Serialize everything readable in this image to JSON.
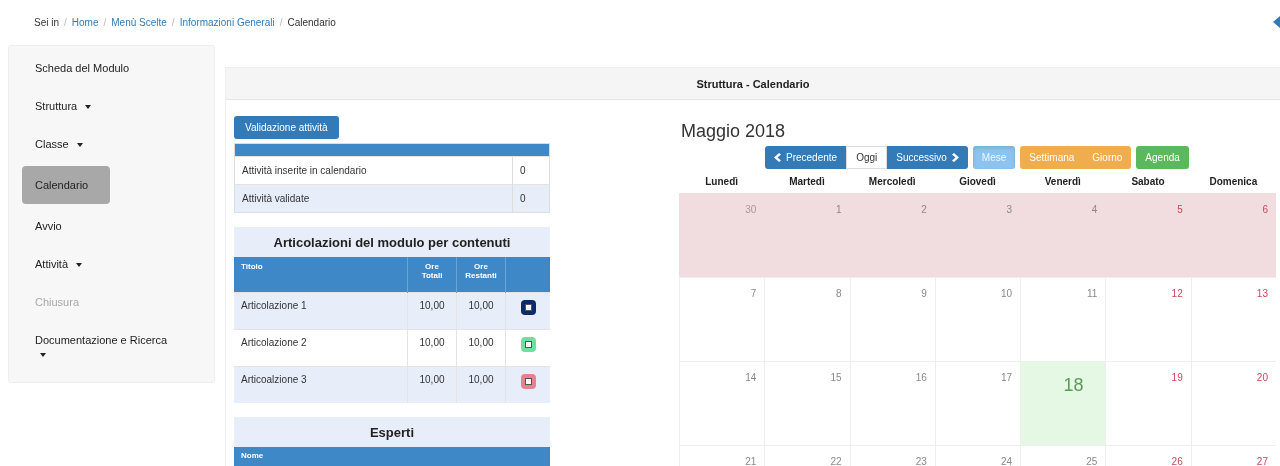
{
  "breadcrumb": {
    "prefix": "Sei in",
    "separator": "/",
    "items": [
      {
        "label": "Home",
        "link": true
      },
      {
        "label": "Menù Scelte",
        "link": true
      },
      {
        "label": "Informazioni Generali",
        "link": true
      },
      {
        "label": "Calendario",
        "link": false
      }
    ]
  },
  "sidebar": {
    "items": [
      {
        "label": "Scheda del Modulo",
        "dropdown": false,
        "selected": false,
        "disabled": false
      },
      {
        "label": "Struttura",
        "dropdown": true,
        "selected": false,
        "disabled": false
      },
      {
        "label": "Classe",
        "dropdown": true,
        "selected": false,
        "disabled": false
      },
      {
        "label": "Calendario",
        "dropdown": false,
        "selected": true,
        "disabled": false
      },
      {
        "label": "Avvio",
        "dropdown": false,
        "selected": false,
        "disabled": false
      },
      {
        "label": "Attività",
        "dropdown": true,
        "selected": false,
        "disabled": false
      },
      {
        "label": "Chiusura",
        "dropdown": false,
        "selected": false,
        "disabled": true
      },
      {
        "label": "Documentazione e Ricerca",
        "dropdown": true,
        "selected": false,
        "disabled": false
      }
    ]
  },
  "panel": {
    "title": "Struttura - Calendario"
  },
  "validation": {
    "button": "Validazione attività",
    "rows": [
      {
        "label": "Attività inserite in calendario",
        "value": "0"
      },
      {
        "label": "Attività validate",
        "value": "0"
      }
    ]
  },
  "articolazioni": {
    "title": "Articolazioni del modulo per contenuti",
    "columns": [
      "Titolo",
      "Ore Totali",
      "Ore Restanti"
    ],
    "rows": [
      {
        "title": "Articolazione 1",
        "ore_totali": "10,00",
        "ore_restanti": "10,00",
        "color": "#0b2a6b"
      },
      {
        "title": "Articolazione 2",
        "ore_totali": "10,00",
        "ore_restanti": "10,00",
        "color": "#6fe0a0"
      },
      {
        "title": "Articoalzione 3",
        "ore_totali": "10,00",
        "ore_restanti": "10,00",
        "color": "#e8808e"
      }
    ]
  },
  "esperti": {
    "title": "Esperti",
    "columns": [
      "Nome"
    ]
  },
  "calendar": {
    "title": "Maggio 2018",
    "nav": [
      {
        "label": "Precedente",
        "kind": "prev"
      },
      {
        "label": "Oggi",
        "kind": "today"
      },
      {
        "label": "Successivo",
        "kind": "next"
      }
    ],
    "views": [
      {
        "label": "Mese",
        "color": "#8cc4ef",
        "selected": true
      },
      {
        "label": "Settimana",
        "color": "#f0ad4e",
        "selected": false
      },
      {
        "label": "Giorno",
        "color": "#f0ad4e",
        "selected": false
      },
      {
        "label": "Agenda",
        "color": "#5cb85c",
        "selected": false
      }
    ],
    "weekdays": [
      "Lunedì",
      "Martedì",
      "Mercoledì",
      "Giovedì",
      "Venerdì",
      "Sabato",
      "Domenica"
    ],
    "weeks": [
      {
        "highlighted": true,
        "days": [
          {
            "label": "30",
            "kind": "other",
            "today": false
          },
          {
            "label": "1",
            "kind": "weekday",
            "today": false
          },
          {
            "label": "2",
            "kind": "weekday",
            "today": false
          },
          {
            "label": "3",
            "kind": "weekday",
            "today": false
          },
          {
            "label": "4",
            "kind": "weekday",
            "today": false
          },
          {
            "label": "5",
            "kind": "weekend",
            "today": false
          },
          {
            "label": "6",
            "kind": "weekend",
            "today": false
          }
        ]
      },
      {
        "highlighted": false,
        "days": [
          {
            "label": "7",
            "kind": "weekday",
            "today": false
          },
          {
            "label": "8",
            "kind": "weekday",
            "today": false
          },
          {
            "label": "9",
            "kind": "weekday",
            "today": false
          },
          {
            "label": "10",
            "kind": "weekday",
            "today": false
          },
          {
            "label": "11",
            "kind": "weekday",
            "today": false
          },
          {
            "label": "12",
            "kind": "weekend",
            "today": false
          },
          {
            "label": "13",
            "kind": "weekend",
            "today": false
          }
        ]
      },
      {
        "highlighted": false,
        "days": [
          {
            "label": "14",
            "kind": "weekday",
            "today": false
          },
          {
            "label": "15",
            "kind": "weekday",
            "today": false
          },
          {
            "label": "16",
            "kind": "weekday",
            "today": false
          },
          {
            "label": "17",
            "kind": "weekday",
            "today": false
          },
          {
            "label": "18",
            "kind": "weekday",
            "today": true
          },
          {
            "label": "19",
            "kind": "weekend",
            "today": false
          },
          {
            "label": "20",
            "kind": "weekend",
            "today": false
          }
        ]
      },
      {
        "highlighted": false,
        "days": [
          {
            "label": "21",
            "kind": "weekday",
            "today": false
          },
          {
            "label": "22",
            "kind": "weekday",
            "today": false
          },
          {
            "label": "23",
            "kind": "weekday",
            "today": false
          },
          {
            "label": "24",
            "kind": "weekday",
            "today": false
          },
          {
            "label": "25",
            "kind": "weekday",
            "today": false
          },
          {
            "label": "26",
            "kind": "weekend",
            "today": false
          },
          {
            "label": "27",
            "kind": "weekend",
            "today": false
          }
        ]
      }
    ]
  }
}
